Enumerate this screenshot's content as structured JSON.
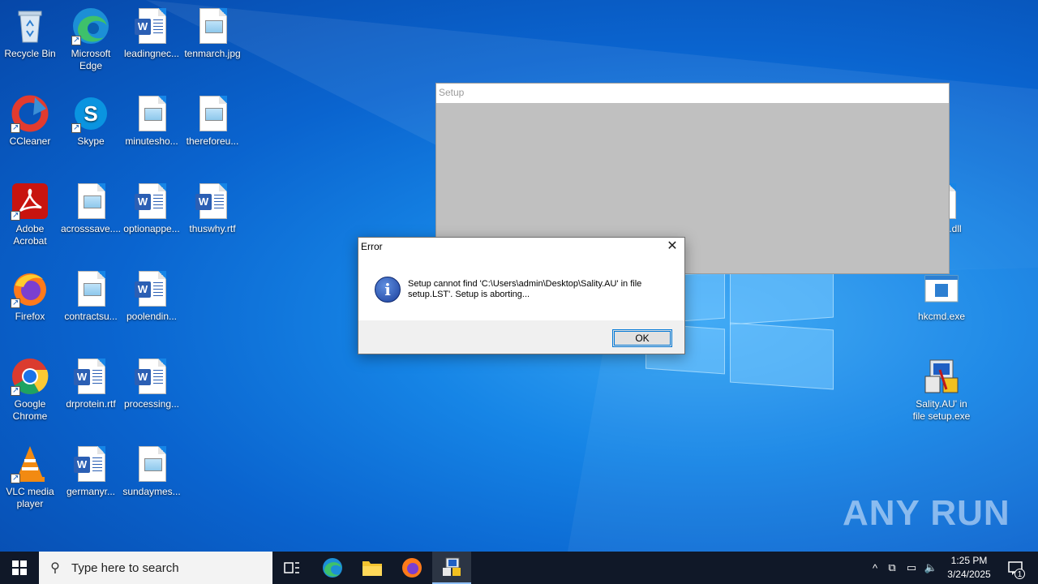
{
  "desktop_icons": [
    {
      "label": "Recycle Bin",
      "icon": "recycle-bin-icon"
    },
    {
      "label": "Microsoft Edge",
      "icon": "edge-icon"
    },
    {
      "label": "leadingnec...",
      "icon": "word-doc-icon"
    },
    {
      "label": "tenmarch.jpg",
      "icon": "image-file-icon"
    },
    {
      "label": "CCleaner",
      "icon": "ccleaner-icon"
    },
    {
      "label": "Skype",
      "icon": "skype-icon"
    },
    {
      "label": "minutesho...",
      "icon": "image-file-icon"
    },
    {
      "label": "thereforeu...",
      "icon": "image-file-icon"
    },
    {
      "label": "Adobe Acrobat",
      "icon": "acrobat-icon"
    },
    {
      "label": "acrosssave....",
      "icon": "image-file-icon"
    },
    {
      "label": "optionappe...",
      "icon": "word-doc-icon"
    },
    {
      "label": "thuswhy.rtf",
      "icon": "word-doc-icon"
    },
    {
      "label": "Firefox",
      "icon": "firefox-icon"
    },
    {
      "label": "contractsu...",
      "icon": "image-file-icon"
    },
    {
      "label": "poolendin...",
      "icon": "word-doc-icon"
    },
    {
      "label": "Google Chrome",
      "icon": "chrome-icon"
    },
    {
      "label": "drprotein.rtf",
      "icon": "word-doc-icon"
    },
    {
      "label": "processing...",
      "icon": "word-doc-icon"
    },
    {
      "label": "VLC media player",
      "icon": "vlc-icon"
    },
    {
      "label": "germanyr...",
      "icon": "word-doc-icon"
    },
    {
      "label": "sundaymes...",
      "icon": "image-file-icon"
    }
  ],
  "right_icons": [
    {
      "label": "s.dll",
      "icon": "dll-file-icon"
    },
    {
      "label": "hkcmd.exe",
      "icon": "exe-icon"
    },
    {
      "label": "Sality.AU' in file setup.exe",
      "icon": "setup-exe-icon"
    }
  ],
  "setup_window": {
    "title": "Setup"
  },
  "error_dialog": {
    "title": "Error",
    "message": "Setup cannot find 'C:\\Users\\admin\\Desktop\\Sality.AU' in file setup.LST'.  Setup is aborting...",
    "ok_label": "OK"
  },
  "watermark": "ANY RUN",
  "taskbar": {
    "search_placeholder": "Type here to search",
    "time": "1:25 PM",
    "date": "3/24/2025",
    "notification_count": "1"
  }
}
